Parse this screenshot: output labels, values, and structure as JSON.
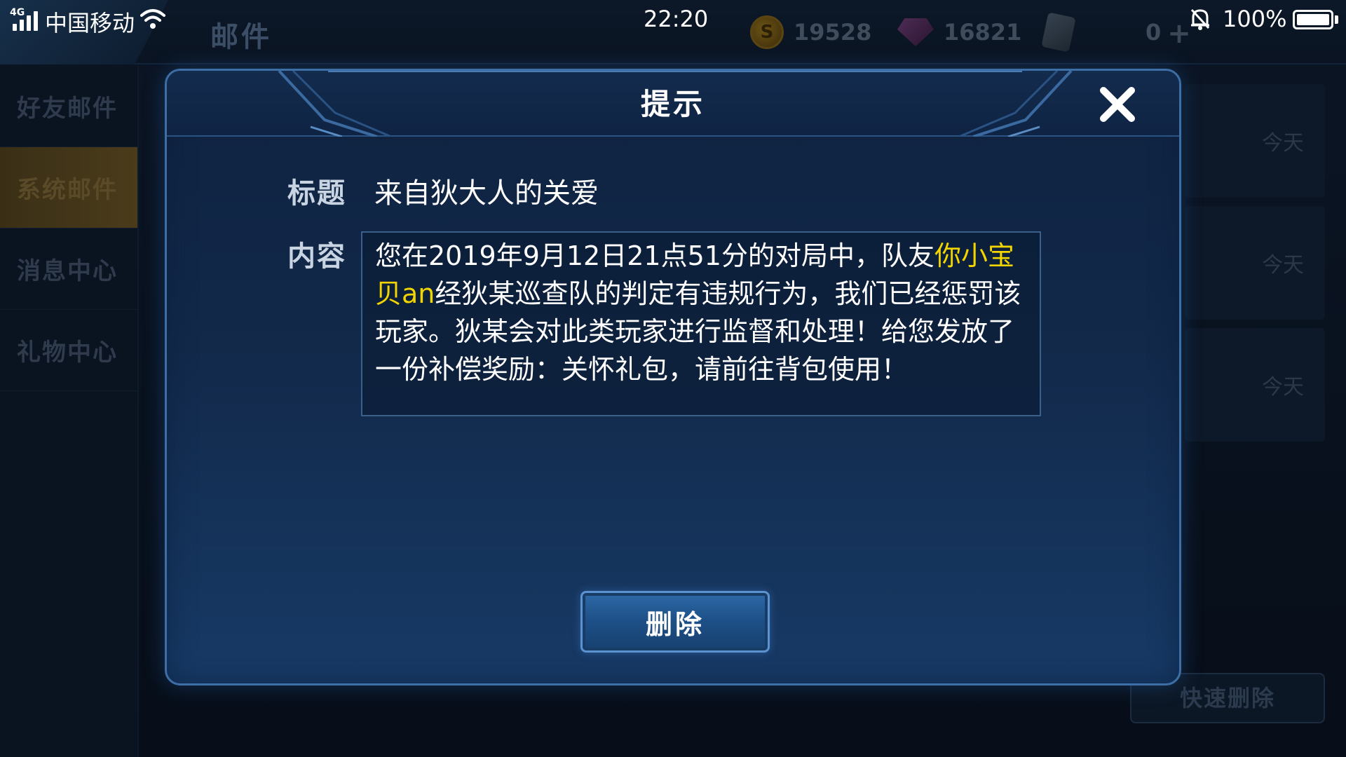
{
  "status_bar": {
    "network": "4G",
    "carrier": "中国移动",
    "time": "22:20",
    "battery": "100%"
  },
  "background": {
    "page_title": "邮件",
    "resources": {
      "gold": "19528",
      "diamonds": "16821",
      "tickets": "0"
    },
    "sidebar": [
      {
        "label": "好友邮件",
        "active": false
      },
      {
        "label": "系统邮件",
        "active": true
      },
      {
        "label": "消息中心",
        "active": false
      },
      {
        "label": "礼物中心",
        "active": false
      }
    ],
    "mail_dates": [
      "今天",
      "今天",
      "今天"
    ],
    "quick_delete": "快速删除"
  },
  "dialog": {
    "title": "提示",
    "title_label": "标题",
    "mail_title": "来自狄大人的关爱",
    "content_label": "内容",
    "content_before": "您在2019年9月12日21点51分的对局中，队友",
    "content_highlight": "你小宝贝an",
    "content_after": "经狄某巡查队的判定有违规行为，我们已经惩罚该玩家。狄某会对此类玩家进行监督和处理！给您发放了一份补偿奖励：关怀礼包，请前往背包使用！",
    "delete_label": "删除"
  },
  "colors": {
    "highlight": "#f2d400",
    "dialog_border": "#3d6fa6",
    "button_blue": "#2d6aa8"
  },
  "icons": [
    "signal-icon",
    "wifi-icon",
    "bell-icon",
    "battery-icon",
    "close-icon",
    "coin-icon",
    "gem-icon",
    "ticket-icon",
    "plus-icon"
  ]
}
